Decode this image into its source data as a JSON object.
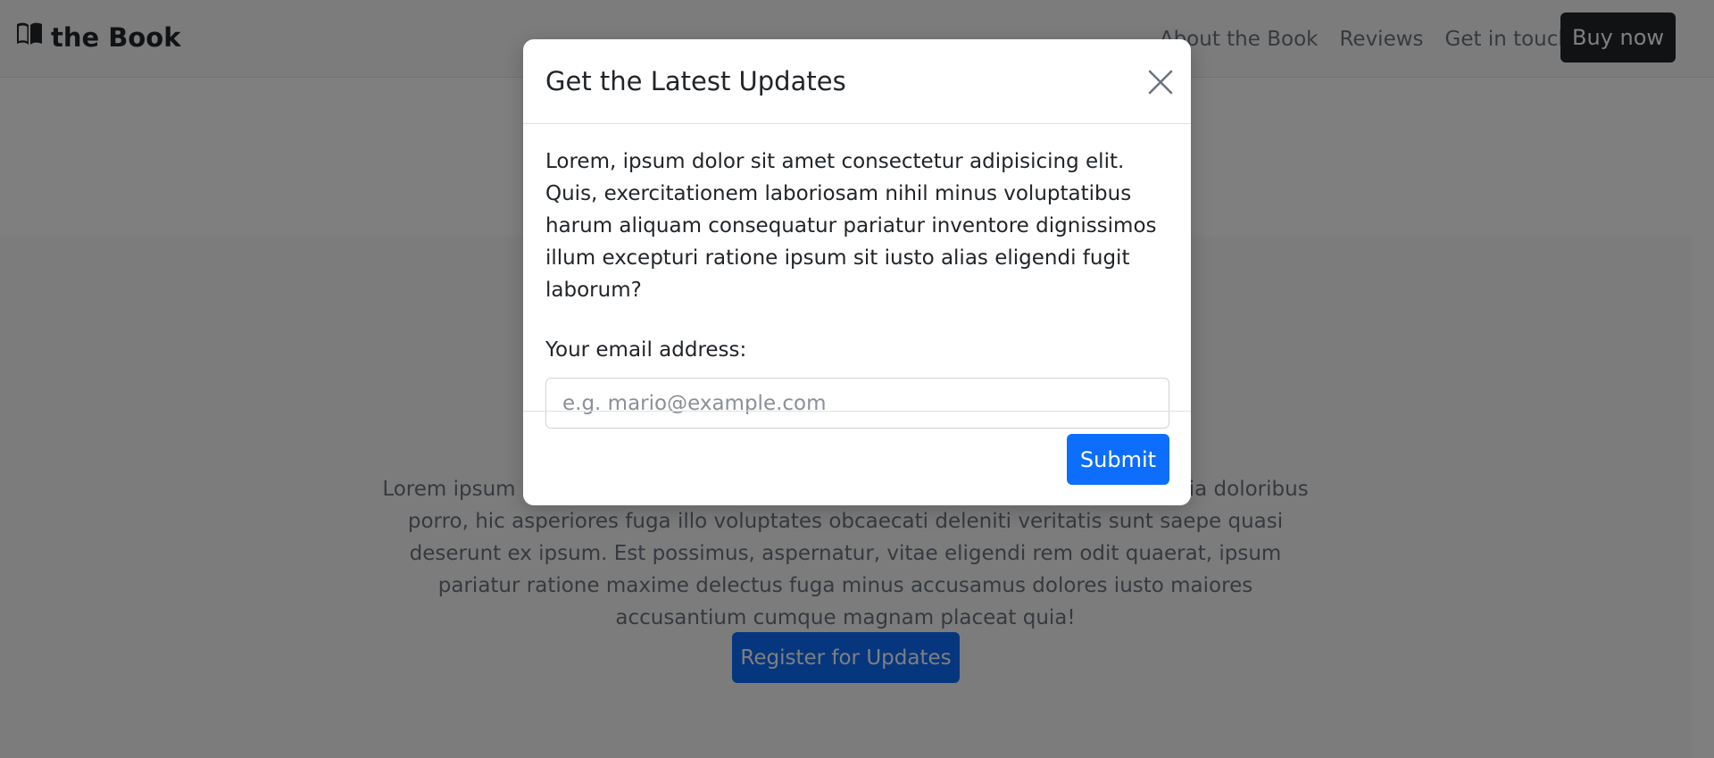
{
  "navbar": {
    "brand": "the Book",
    "links": [
      "About the Book",
      "Reviews",
      "Get in touch"
    ],
    "buy_label": "Buy now"
  },
  "hero": {
    "text": "Lorem ipsum dolor sit amet consectetur adipisicing elit. Nobis illum ullam officia doloribus porro, hic asperiores fuga illo voluptates obcaecati deleniti veritatis sunt saepe quasi deserunt ex ipsum. Est possimus, aspernatur, vitae eligendi rem odit quaerat, ipsum pariatur ratione maxime delectus fuga minus accusamus dolores iusto maiores accusantium cumque magnam placeat quia!",
    "register_label": "Register for Updates"
  },
  "modal": {
    "title": "Get the Latest Updates",
    "body": "Lorem, ipsum dolor sit amet consectetur adipisicing elit. Quis, exercitationem laboriosam nihil minus voluptatibus harum aliquam consequatur pariatur inventore dignissimos illum excepturi ratione ipsum sit iusto alias eligendi fugit laborum?",
    "email_label": "Your email address:",
    "email_placeholder": "e.g. mario@example.com",
    "email_value": "",
    "submit_label": "Submit"
  },
  "icons": {
    "brand": "book-icon",
    "close": "close-icon"
  },
  "colors": {
    "primary": "#0d6efd",
    "dark": "#212529",
    "backdrop": "rgba(0,0,0,0.5)"
  }
}
